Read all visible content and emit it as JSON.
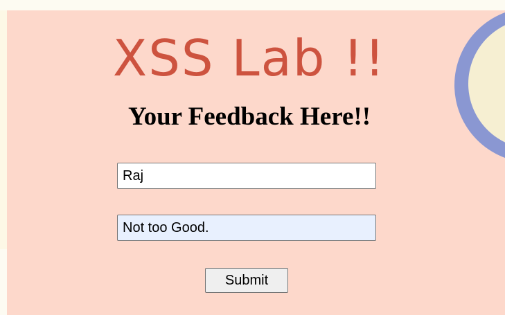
{
  "header": {
    "title": "XSS Lab !!",
    "subtitle": "Your Feedback Here!!"
  },
  "form": {
    "name_value": "Raj",
    "feedback_value": "Not too Good.",
    "submit_label": "Submit"
  },
  "colors": {
    "background": "#fdd8cb",
    "title": "#cd533f",
    "autofill_field": "#e8f0fe",
    "decor_ring": "#8a97d2"
  }
}
